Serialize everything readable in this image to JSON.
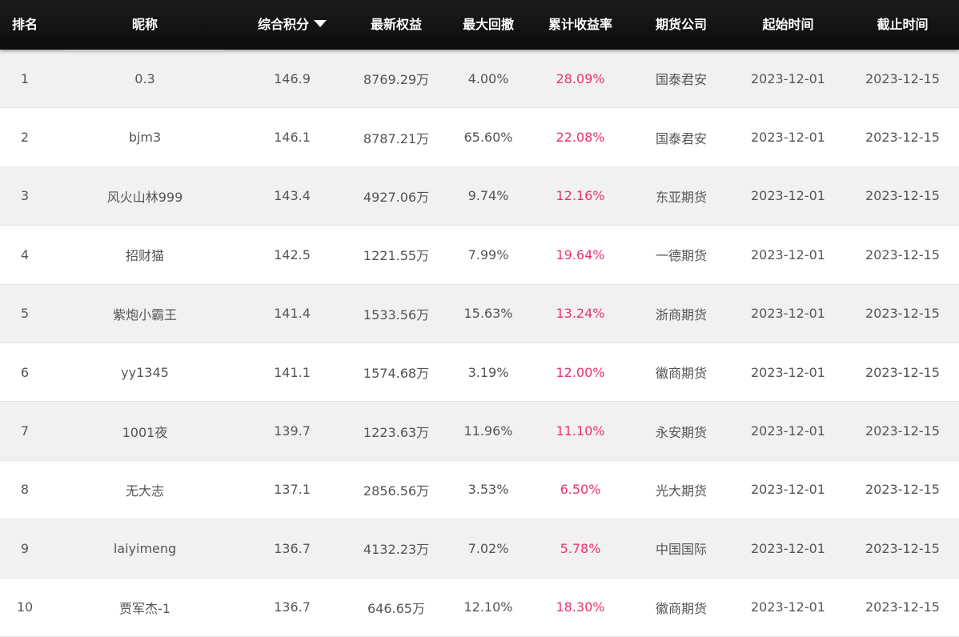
{
  "header": {
    "rank": "排名",
    "nickname": "昵称",
    "score": "综合积分",
    "equity": "最新权益",
    "max_drawdown": "最大回撤",
    "cum_return": "累计收益率",
    "firm": "期货公司",
    "start": "起始时间",
    "end": "截止时间"
  },
  "sort_icon": "caret-down-icon",
  "colors": {
    "header_bg": "#111111",
    "row_odd": "#f1f1f1",
    "row_even": "#ffffff",
    "rate": "#e8336f",
    "text": "#555555"
  },
  "rows": [
    {
      "rank": "1",
      "nickname": "0.3",
      "score": "146.9",
      "equity": "8769.29万",
      "max_drawdown": "4.00%",
      "cum_return": "28.09%",
      "firm": "国泰君安",
      "start": "2023-12-01",
      "end": "2023-12-15"
    },
    {
      "rank": "2",
      "nickname": "bjm3",
      "score": "146.1",
      "equity": "8787.21万",
      "max_drawdown": "65.60%",
      "cum_return": "22.08%",
      "firm": "国泰君安",
      "start": "2023-12-01",
      "end": "2023-12-15"
    },
    {
      "rank": "3",
      "nickname": "风火山林999",
      "score": "143.4",
      "equity": "4927.06万",
      "max_drawdown": "9.74%",
      "cum_return": "12.16%",
      "firm": "东亚期货",
      "start": "2023-12-01",
      "end": "2023-12-15"
    },
    {
      "rank": "4",
      "nickname": "招财猫",
      "score": "142.5",
      "equity": "1221.55万",
      "max_drawdown": "7.99%",
      "cum_return": "19.64%",
      "firm": "一德期货",
      "start": "2023-12-01",
      "end": "2023-12-15"
    },
    {
      "rank": "5",
      "nickname": "紫炮小霸王",
      "score": "141.4",
      "equity": "1533.56万",
      "max_drawdown": "15.63%",
      "cum_return": "13.24%",
      "firm": "浙商期货",
      "start": "2023-12-01",
      "end": "2023-12-15"
    },
    {
      "rank": "6",
      "nickname": "yy1345",
      "score": "141.1",
      "equity": "1574.68万",
      "max_drawdown": "3.19%",
      "cum_return": "12.00%",
      "firm": "徽商期货",
      "start": "2023-12-01",
      "end": "2023-12-15"
    },
    {
      "rank": "7",
      "nickname": "1001夜",
      "score": "139.7",
      "equity": "1223.63万",
      "max_drawdown": "11.96%",
      "cum_return": "11.10%",
      "firm": "永安期货",
      "start": "2023-12-01",
      "end": "2023-12-15"
    },
    {
      "rank": "8",
      "nickname": "无大志",
      "score": "137.1",
      "equity": "2856.56万",
      "max_drawdown": "3.53%",
      "cum_return": "6.50%",
      "firm": "光大期货",
      "start": "2023-12-01",
      "end": "2023-12-15"
    },
    {
      "rank": "9",
      "nickname": "laiyimeng",
      "score": "136.7",
      "equity": "4132.23万",
      "max_drawdown": "7.02%",
      "cum_return": "5.78%",
      "firm": "中国国际",
      "start": "2023-12-01",
      "end": "2023-12-15"
    },
    {
      "rank": "10",
      "nickname": "贾军杰-1",
      "score": "136.7",
      "equity": "646.65万",
      "max_drawdown": "12.10%",
      "cum_return": "18.30%",
      "firm": "徽商期货",
      "start": "2023-12-01",
      "end": "2023-12-15"
    }
  ]
}
